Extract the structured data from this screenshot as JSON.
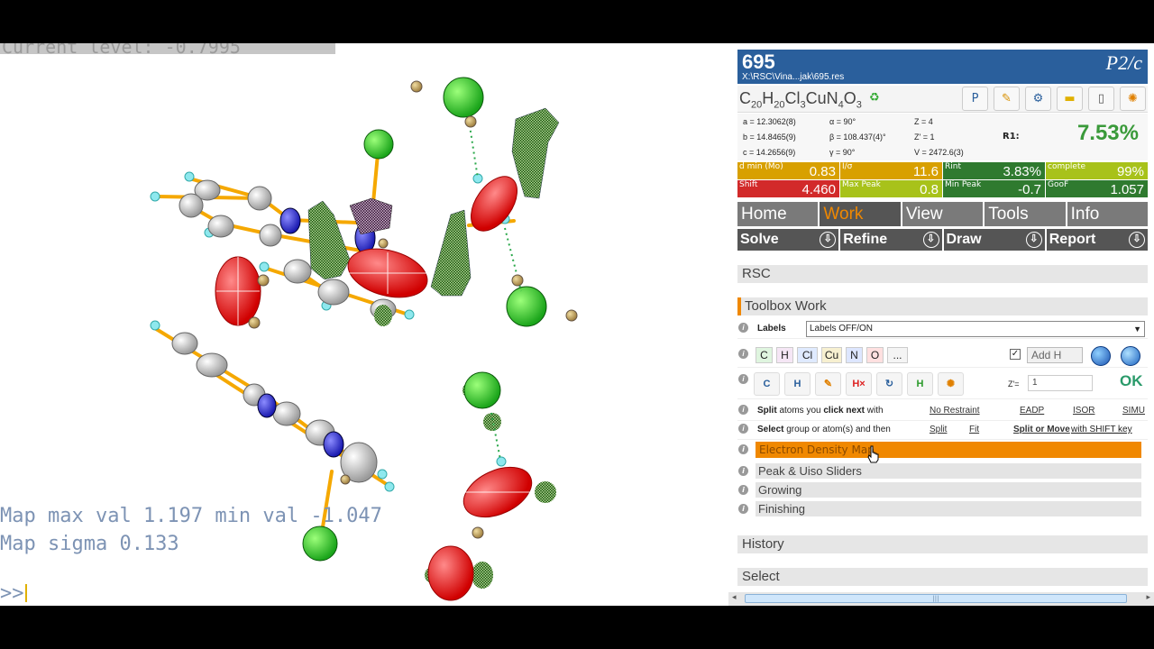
{
  "viewer": {
    "level_text": "Current level: -0.7995",
    "map_max_line": "Map max val 1.197 min val -1.047",
    "map_sigma_line": "Map sigma 0.133",
    "prompt": ">>"
  },
  "header": {
    "structure_id": "695",
    "path": "X:\\RSC\\Vina...jak\\695.res",
    "space_group": "P2/c"
  },
  "formula": {
    "parts": [
      [
        "C",
        "20"
      ],
      [
        "H",
        "20"
      ],
      [
        "Cl",
        "3"
      ],
      [
        "Cu",
        ""
      ],
      [
        "N",
        "4"
      ],
      [
        "O",
        "3"
      ]
    ],
    "icons": [
      "pton-icon",
      "pencil-icon",
      "model-icon",
      "folder-icon",
      "notepad-icon",
      "atom-settings-icon"
    ]
  },
  "cell": {
    "a": "a = 12.3062(8)",
    "b": "b = 14.8465(9)",
    "c": "c = 14.2656(9)",
    "alpha": "α = 90°",
    "beta": "β = 108.437(4)°",
    "gamma": "γ = 90°",
    "z": "Z = 4",
    "zprime": "Z' = 1",
    "v": "V = 2472.6(3)",
    "r1_label": "R1:",
    "r1_value": "7.53%"
  },
  "stats": [
    {
      "label": "d min (Mo)",
      "value": "0.83",
      "color": "#d8a000"
    },
    {
      "label": "I/σ",
      "value": "11.6",
      "color": "#d8a000"
    },
    {
      "label": "Rint",
      "value": "3.83%",
      "color": "#2f7a2f"
    },
    {
      "label": "complete",
      "value": "99%",
      "color": "#a8c21a"
    },
    {
      "label": "Shift",
      "value": "4.460",
      "color": "#d22a2a"
    },
    {
      "label": "Max Peak",
      "value": "0.8",
      "color": "#a8c21a"
    },
    {
      "label": "Min Peak",
      "value": "-0.7",
      "color": "#2f7a2f"
    },
    {
      "label": "GooF",
      "value": "1.057",
      "color": "#2f7a2f"
    }
  ],
  "tabs": [
    "Home",
    "Work",
    "View",
    "Tools",
    "Info"
  ],
  "active_tab": "Work",
  "subtabs": [
    "Solve",
    "Refine",
    "Draw",
    "Report"
  ],
  "sections": {
    "rsc": "RSC",
    "toolbox": "Toolbox Work",
    "history": "History",
    "select": "Select"
  },
  "toolbox": {
    "labels_label": "Labels",
    "labels_value": "Labels OFF/ON",
    "elements": [
      "C",
      "H",
      "Cl",
      "Cu",
      "N",
      "O",
      "..."
    ],
    "add_h_label": "Add H",
    "tool_icons": [
      "C",
      "H",
      "",
      "H",
      "",
      "",
      ""
    ],
    "zprime_label": "Z'=",
    "zprime_value": "1",
    "ok_label": "OK",
    "split_prefix": "Split",
    "split_mid": "atoms you",
    "split_click": "click next",
    "split_suffix": "with",
    "no_restraint": "No Restraint",
    "eadp": "EADP",
    "isor": "ISOR",
    "simu": "SIMU",
    "select_prefix": "Select",
    "select_mid": "group or atom(s) and then",
    "select_split": "Split",
    "select_fit": "Fit",
    "select_splitmove": "Split or Move",
    "select_shift": "with SHIFT key"
  },
  "subsections": [
    "Electron Density Map",
    "Peak & Uiso Sliders",
    "Growing",
    "Finishing"
  ],
  "colors": {
    "header_blue": "#2a5f9c",
    "accent_orange": "#f08800",
    "tab_gray": "#7a7a7a"
  }
}
